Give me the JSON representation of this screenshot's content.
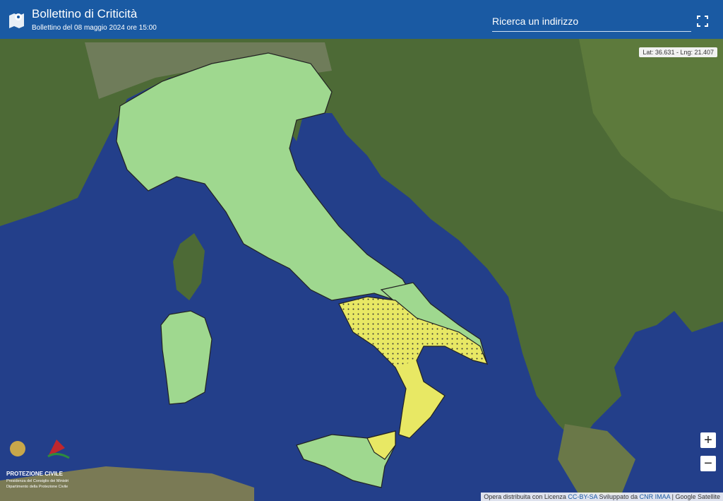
{
  "header": {
    "title": "Bollettino di Criticità",
    "subtitle": "Bollettino del 08 maggio 2024 ore 15:00",
    "search_placeholder": "Ricerca un indirizzo",
    "map_icon": "map-pin-icon",
    "fullscreen_icon": "fullscreen-icon"
  },
  "map": {
    "coords": "Lat: 36.631 - Lng: 21.407",
    "zoom_in": "+",
    "zoom_out": "−",
    "attribution_prefix": "Opera distribuita con Licenza ",
    "license_link": "CC-BY-SA",
    "developed_prefix": " Sviluppato da ",
    "developer_link": "CNR IMAA",
    "attribution_suffix": " | Google Satellite",
    "legend_colors": {
      "green": "#9fd88f",
      "yellow": "#e8e864",
      "sea": "#2b4d9a"
    }
  },
  "logo": {
    "name": "PROTEZIONE CIVILE",
    "line1": "Presidenza del Consiglio dei Ministri",
    "line2": "Dipartimento della Protezione Civile"
  }
}
